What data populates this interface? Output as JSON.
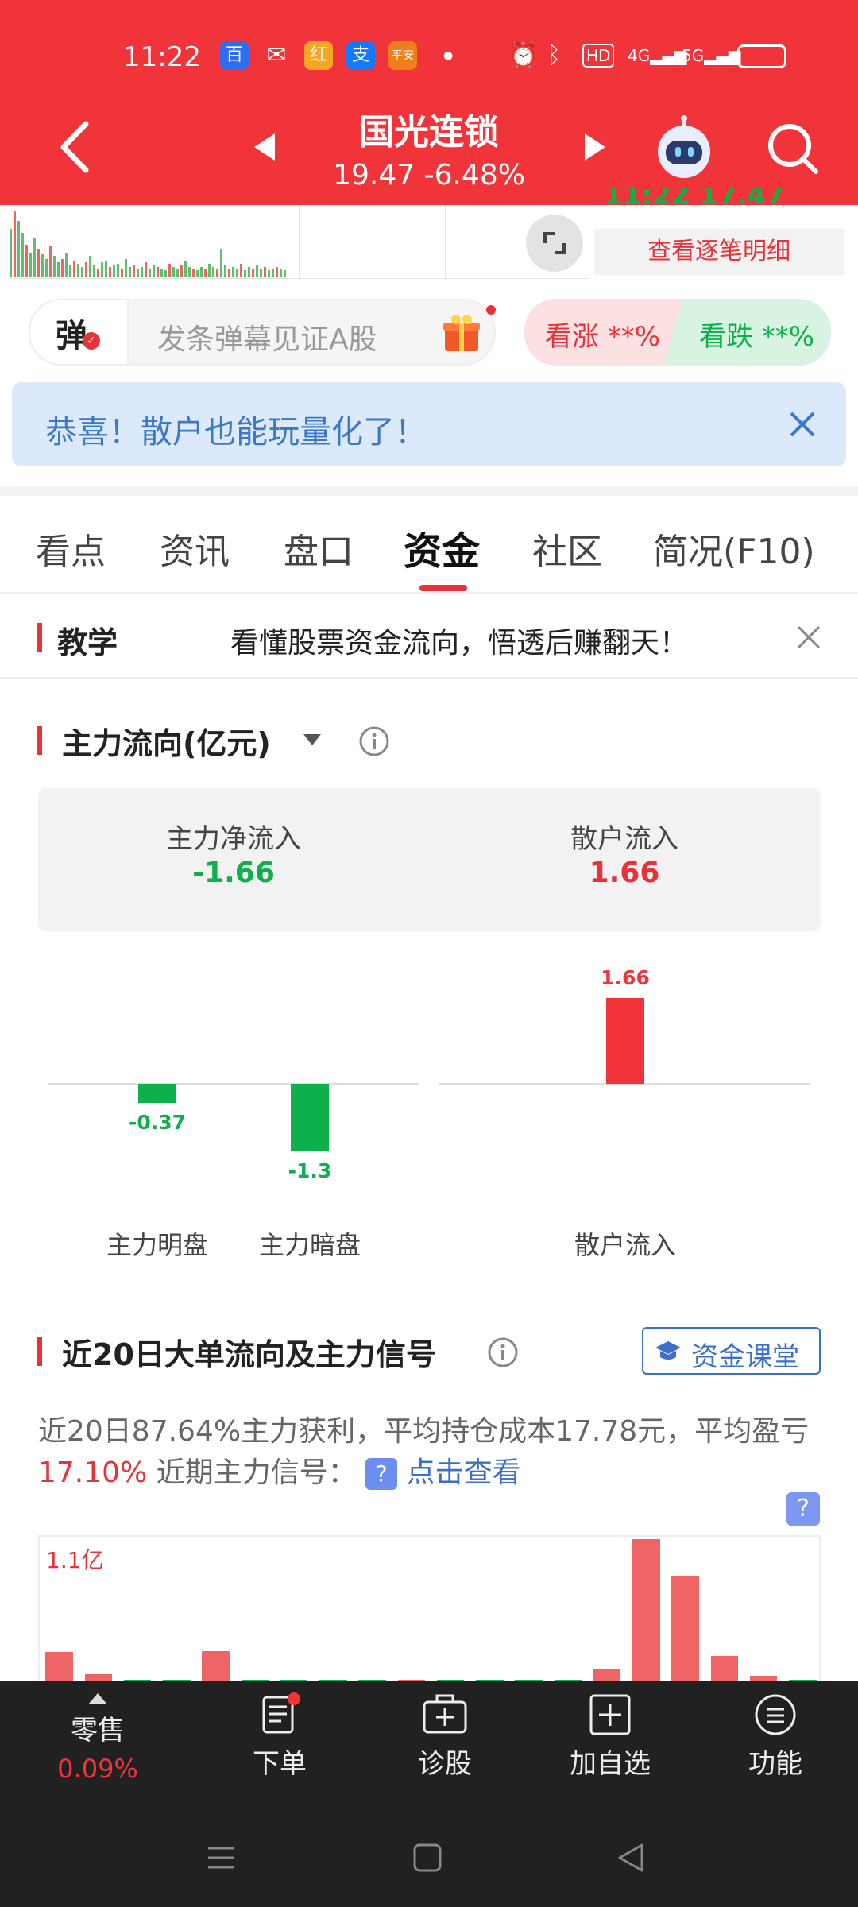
{
  "status": {
    "time": "11:22",
    "apps": [
      "百",
      "微",
      "红",
      "支",
      "平安"
    ],
    "right_icons": [
      "alarm-icon",
      "bluetooth-icon",
      "hd-icon",
      "4g-signal-icon",
      "5g-signal-icon",
      "battery-icon"
    ],
    "hd_text": "HD",
    "net4": "4G",
    "net5": "5G"
  },
  "header": {
    "title": "国光连锁",
    "price": "19.47",
    "change": "-6.48%"
  },
  "mini": {
    "partial_text": "11:22 17.47",
    "detail_btn": "查看逐笔明细"
  },
  "danmu": {
    "icon_text": "弹",
    "placeholder": "发条弹幕见证A股",
    "bull_label": "看涨 **%",
    "bear_label": "看跌 **%"
  },
  "banner": {
    "text": "恭喜！散户也能玩量化了！"
  },
  "tabs": [
    "看点",
    "资讯",
    "盘口",
    "资金",
    "社区",
    "简况(F10)"
  ],
  "active_tab": "资金",
  "teach": {
    "label": "教学",
    "text": "看懂股票资金流向，悟透后赚翻天！"
  },
  "mainflow": {
    "title": "主力流向(亿元)",
    "net_in_label": "主力净流入",
    "net_in_value": "-1.66",
    "retail_in_label": "散户流入",
    "retail_in_value": "1.66",
    "colors": {
      "down": "#0db04b",
      "up": "#f0343a"
    }
  },
  "chart_data": {
    "type": "bar",
    "categories": [
      "主力明盘",
      "主力暗盘",
      "散户流入"
    ],
    "values": [
      -0.37,
      -1.3,
      1.66
    ],
    "value_labels": [
      "-0.37",
      "-1.3",
      "1.66"
    ]
  },
  "big_order": {
    "title": "近20日大单流向及主力信号",
    "class_btn": "资金课堂",
    "desc_part1": "近20日87.64%主力获利，平均持仓成本17.78元，平均盈亏",
    "desc_pct": "17.10%",
    "desc_part2": " 近期主力信号：",
    "desc_link": "点击查看",
    "y_label": "1.1亿",
    "bars": [
      0.23,
      0.06,
      0.01,
      0.01,
      0.24,
      0.01,
      0.01,
      0.01,
      0.01,
      0.01,
      0.01,
      0.01,
      0.01,
      0.01,
      0.1,
      1.1,
      0.82,
      0.2,
      0.05,
      0.01
    ],
    "bar_colors": [
      "up",
      "up",
      "down",
      "down",
      "up",
      "down",
      "down",
      "down",
      "down",
      "up",
      "down",
      "down",
      "down",
      "down",
      "up",
      "up",
      "up",
      "up",
      "up",
      "down"
    ]
  },
  "bottom": {
    "retail_label": "零售",
    "retail_pct": "0.09%",
    "buttons": [
      "下单",
      "诊股",
      "加自选",
      "功能"
    ]
  }
}
